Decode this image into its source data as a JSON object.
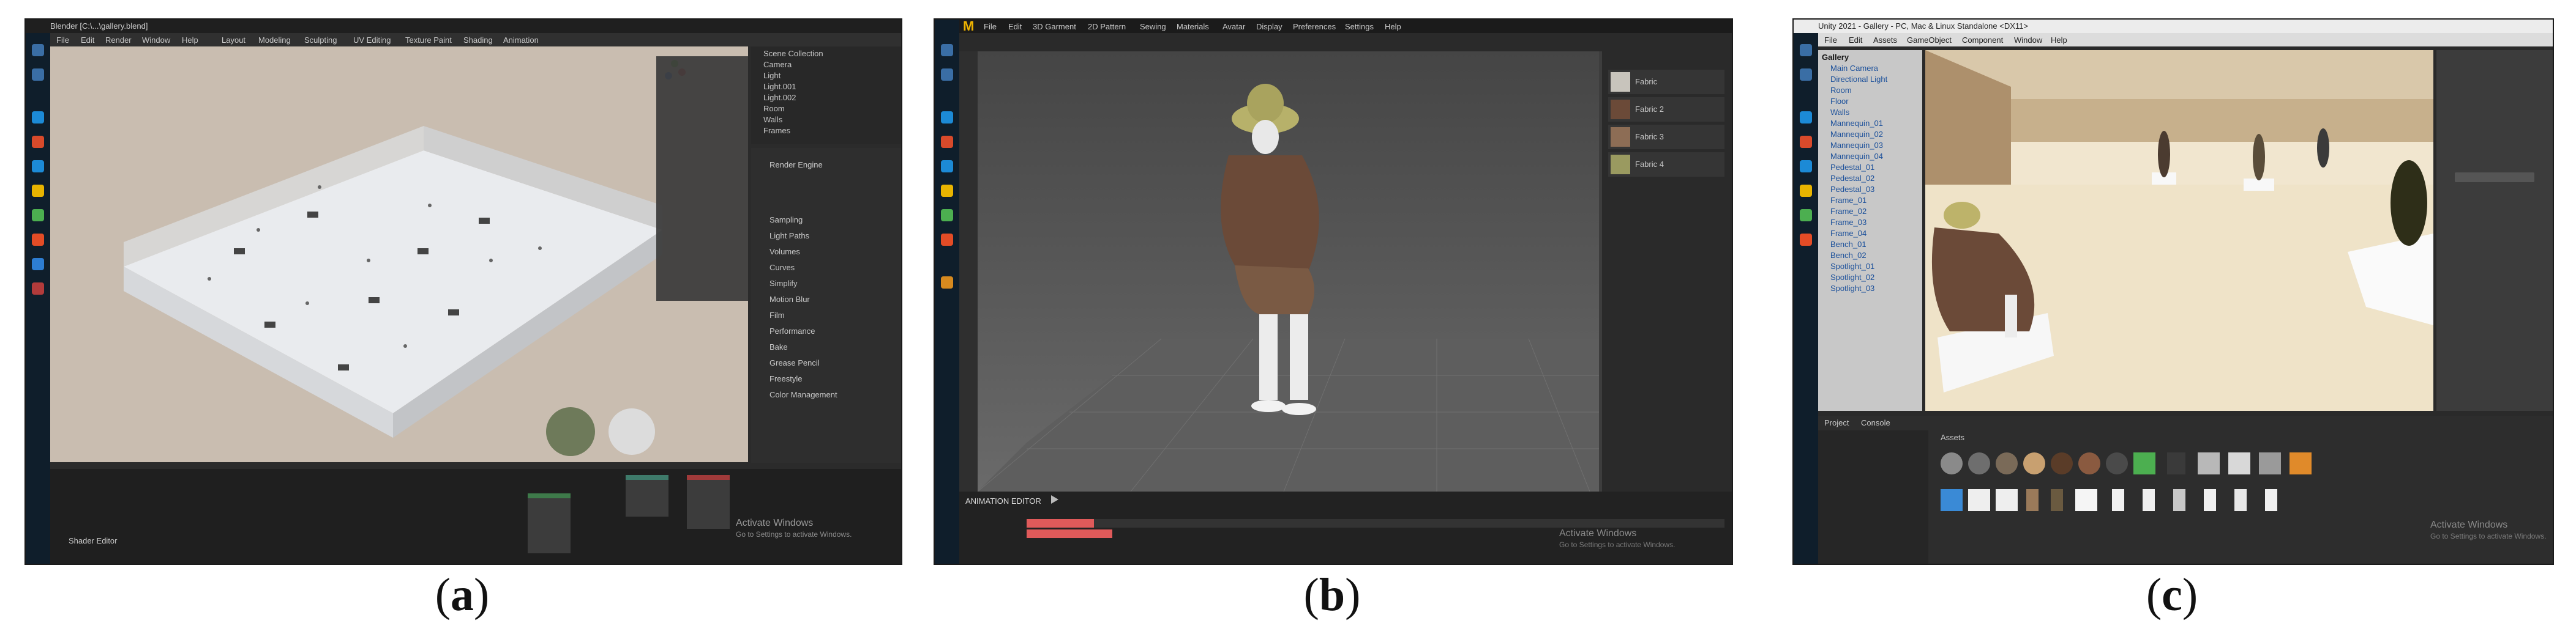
{
  "captions": [
    "a",
    "b",
    "c"
  ],
  "panel_a": {
    "window_title": "Blender [C:\\...\\gallery.blend]",
    "menus": [
      "File",
      "Edit",
      "Render",
      "Window",
      "Help",
      "Layout",
      "Modeling",
      "Sculpting",
      "UV Editing",
      "Texture Paint",
      "Shading",
      "Animation"
    ],
    "outliner_items": [
      "Scene Collection",
      "Camera",
      "Light",
      "Light.001",
      "Light.002",
      "Room",
      "Walls",
      "Frames"
    ],
    "properties_items": [
      "Render Engine",
      "Sampling",
      "Light Paths",
      "Volumes",
      "Curves",
      "Simplify",
      "Motion Blur",
      "Film",
      "Performance",
      "Bake",
      "Grease Pencil",
      "Freestyle",
      "Color Management"
    ],
    "node_editor_label": "Shader Editor",
    "activate_windows": "Activate Windows",
    "activate_sub": "Go to Settings to activate Windows."
  },
  "panel_b": {
    "logo": "M",
    "menus": [
      "File",
      "Edit",
      "3D Garment",
      "2D Pattern",
      "Sewing",
      "Materials",
      "Avatar",
      "Display",
      "Preferences",
      "Settings",
      "Help"
    ],
    "animation_label": "ANIMATION EDITOR",
    "material_list": [
      "Fabric",
      "Fabric 2",
      "Fabric 3",
      "Fabric 4"
    ],
    "material_colors": [
      "#c8c4bc",
      "#6b4a38",
      "#8d6d55",
      "#9a9a60"
    ],
    "activate_windows": "Activate Windows",
    "activate_sub": "Go to Settings to activate Windows."
  },
  "panel_c": {
    "window_title": "Unity 2021 - Gallery - PC, Mac & Linux Standalone <DX11>",
    "menus": [
      "File",
      "Edit",
      "Assets",
      "GameObject",
      "Component",
      "Window",
      "Help"
    ],
    "hierarchy_items": [
      "Gallery",
      "Main Camera",
      "Directional Light",
      "Room",
      "Floor",
      "Walls",
      "Mannequin_01",
      "Mannequin_02",
      "Mannequin_03",
      "Mannequin_04",
      "Pedestal_01",
      "Pedestal_02",
      "Pedestal_03",
      "Frame_01",
      "Frame_02",
      "Frame_03",
      "Frame_04",
      "Bench_01",
      "Bench_02",
      "Spotlight_01",
      "Spotlight_02",
      "Spotlight_03"
    ],
    "project_tabs": [
      "Project",
      "Console"
    ],
    "assets_label": "Assets",
    "activate_windows": "Activate Windows",
    "activate_sub": "Go to Settings to activate Windows."
  }
}
